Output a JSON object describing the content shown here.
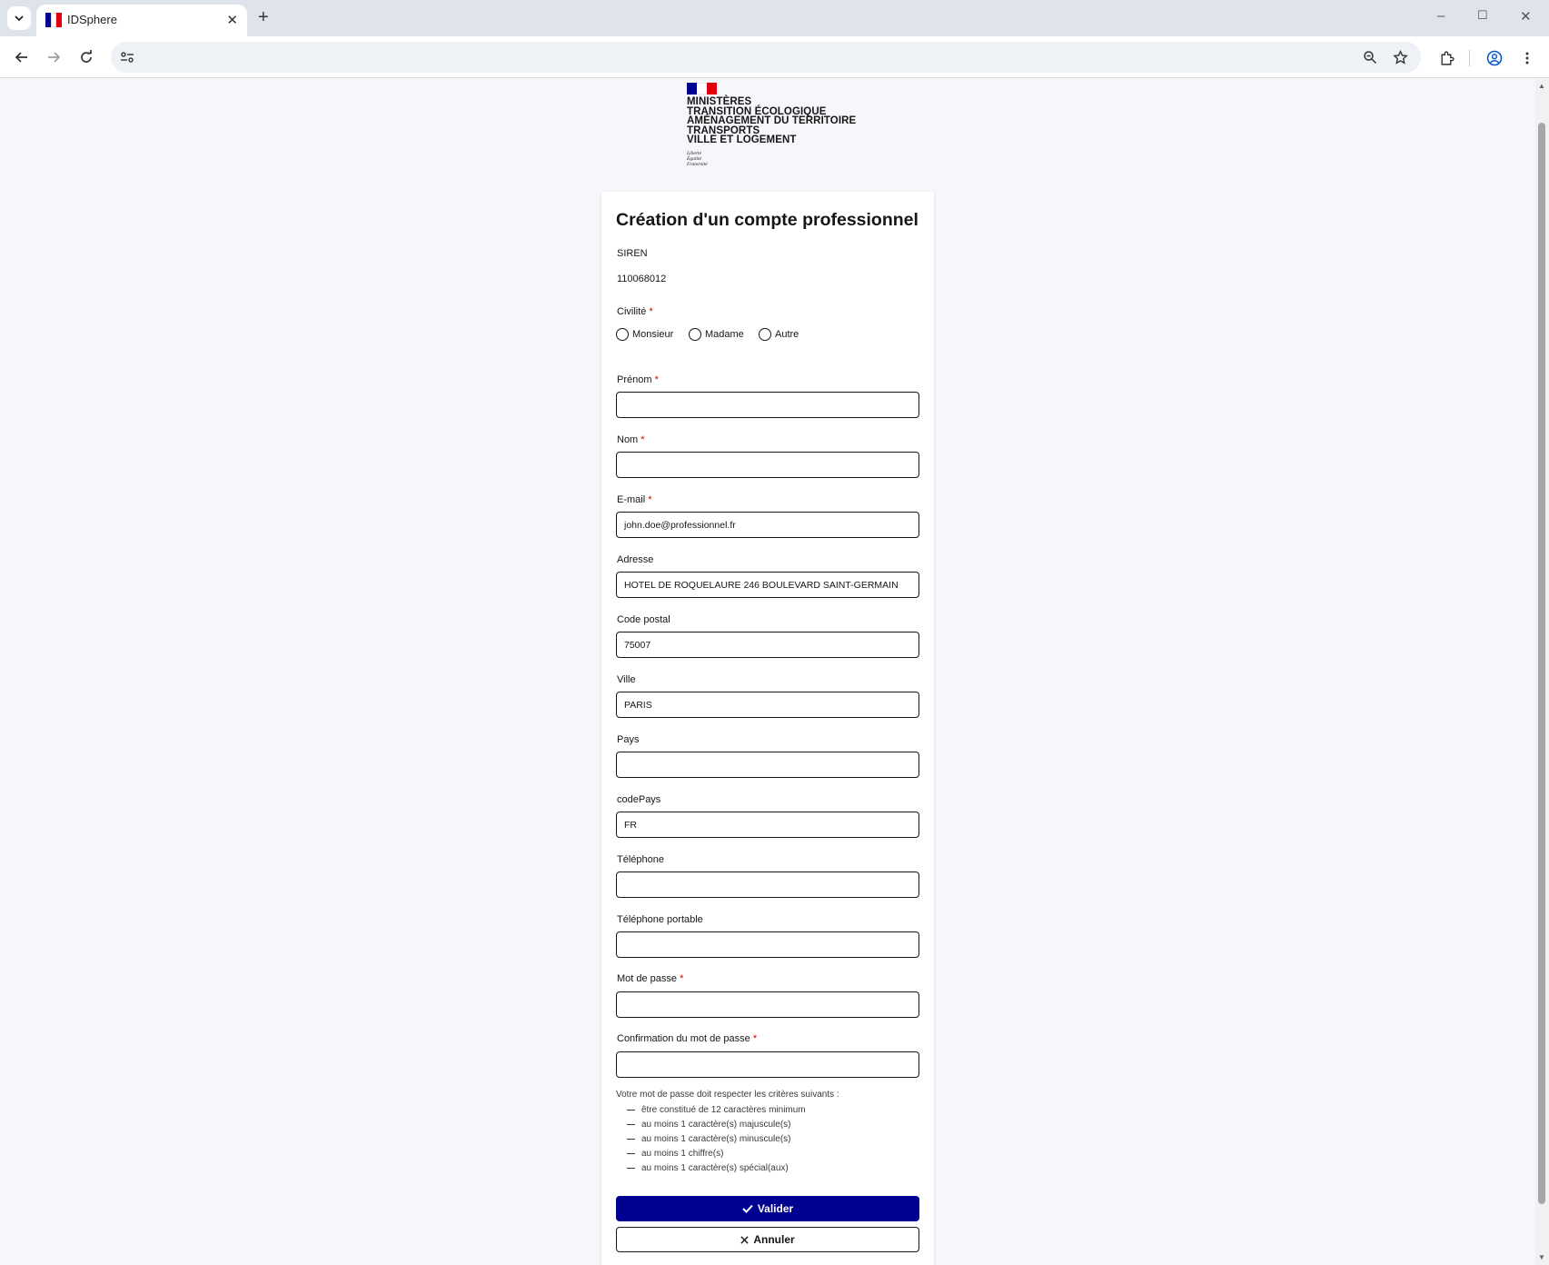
{
  "browser": {
    "tab_title": "IDSphere",
    "new_tab_symbol": "+",
    "close_tab_symbol": "✕",
    "address": "",
    "window_controls": {
      "minimize": "–",
      "maximize": "☐",
      "close": "✕"
    },
    "flag_colors": {
      "blue": "#000091",
      "white": "#ffffff",
      "red": "#e1000f"
    }
  },
  "logo": {
    "lines": [
      "Ministères",
      "Transition écologique",
      "Aménagement du territoire",
      "Transports",
      "Ville et logement"
    ],
    "motto": [
      "Liberté",
      "Égalité",
      "Fraternité"
    ]
  },
  "form": {
    "title": "Création d'un compte professionnel",
    "required_mark": "*",
    "siren": {
      "label": "SIREN",
      "value": "110068012"
    },
    "civilite": {
      "label": "Civilité",
      "options": [
        "Monsieur",
        "Madame",
        "Autre"
      ]
    },
    "fields": {
      "prenom": {
        "label": "Prénom",
        "value": ""
      },
      "nom": {
        "label": "Nom",
        "value": ""
      },
      "email": {
        "label": "E-mail",
        "value": "john.doe@professionnel.fr"
      },
      "adresse": {
        "label": "Adresse",
        "value": "HOTEL DE ROQUELAURE 246 BOULEVARD SAINT-GERMAIN"
      },
      "code_postal": {
        "label": "Code postal",
        "value": "75007"
      },
      "ville": {
        "label": "Ville",
        "value": "PARIS"
      },
      "pays": {
        "label": "Pays",
        "value": ""
      },
      "code_pays": {
        "label": "codePays",
        "value": "FR"
      },
      "telephone": {
        "label": "Téléphone",
        "value": ""
      },
      "telephone_portable": {
        "label": "Téléphone portable",
        "value": ""
      },
      "mot_de_passe": {
        "label": "Mot de passe",
        "value": ""
      },
      "confirmation": {
        "label": "Confirmation du mot de passe",
        "value": ""
      }
    },
    "password_rules": {
      "intro": "Votre mot de passe doit respecter les critères suivants :",
      "items": [
        "être constitué de 12 caractères minimum",
        "au moins 1 caractère(s) majuscule(s)",
        "au moins 1 caractère(s) minuscule(s)",
        "au moins 1 chiffre(s)",
        "au moins 1 caractère(s) spécial(aux)"
      ]
    },
    "submit_label": "Valider",
    "cancel_label": "Annuler",
    "primary_color": "#000091",
    "required_color": "#ce0500"
  }
}
